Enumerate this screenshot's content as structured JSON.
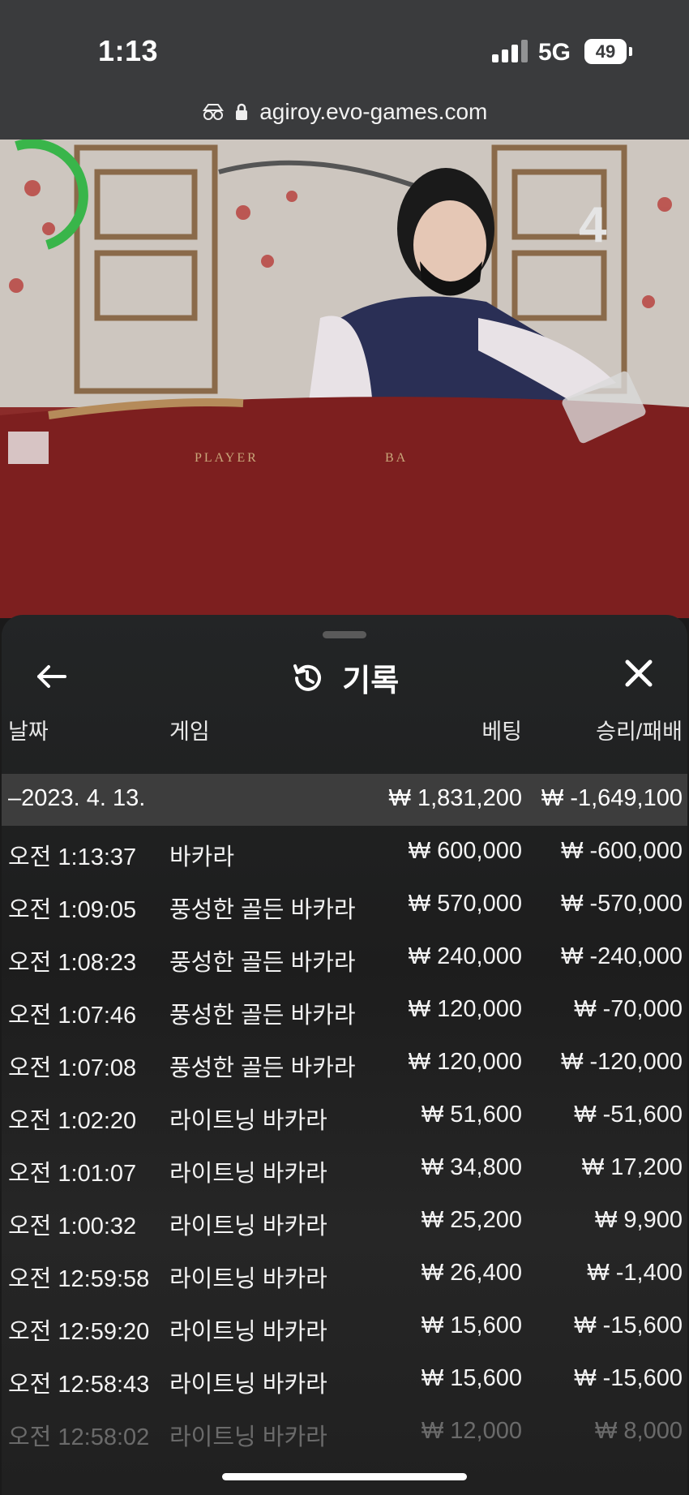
{
  "status_bar": {
    "time": "1:13",
    "network": "5G",
    "battery": "49"
  },
  "browser": {
    "url": "agiroy.evo-games.com"
  },
  "video": {
    "table_text_left": "PLAYER",
    "table_text_right": "BA",
    "countdown": "4"
  },
  "history": {
    "title": "기록",
    "columns": {
      "date": "날짜",
      "game": "게임",
      "bet": "베팅",
      "win_loss": "승리/패배"
    },
    "summary": {
      "date": "–2023. 4. 13.",
      "bet": "₩ 1,831,200",
      "win_loss": "₩ -1,649,100"
    },
    "rows": [
      {
        "time": "오전 1:13:37",
        "game": "바카라",
        "bet": "₩ 600,000",
        "win_loss": "₩ -600,000"
      },
      {
        "time": "오전 1:09:05",
        "game": "풍성한 골든 바카라",
        "bet": "₩ 570,000",
        "win_loss": "₩ -570,000"
      },
      {
        "time": "오전 1:08:23",
        "game": "풍성한 골든 바카라",
        "bet": "₩ 240,000",
        "win_loss": "₩ -240,000"
      },
      {
        "time": "오전 1:07:46",
        "game": "풍성한 골든 바카라",
        "bet": "₩ 120,000",
        "win_loss": "₩ -70,000"
      },
      {
        "time": "오전 1:07:08",
        "game": "풍성한 골든 바카라",
        "bet": "₩ 120,000",
        "win_loss": "₩ -120,000"
      },
      {
        "time": "오전 1:02:20",
        "game": "라이트닝 바카라",
        "bet": "₩ 51,600",
        "win_loss": "₩ -51,600"
      },
      {
        "time": "오전 1:01:07",
        "game": "라이트닝 바카라",
        "bet": "₩ 34,800",
        "win_loss": "₩ 17,200"
      },
      {
        "time": "오전 1:00:32",
        "game": "라이트닝 바카라",
        "bet": "₩ 25,200",
        "win_loss": "₩ 9,900"
      },
      {
        "time": "오전 12:59:58",
        "game": "라이트닝 바카라",
        "bet": "₩ 26,400",
        "win_loss": "₩ -1,400"
      },
      {
        "time": "오전 12:59:20",
        "game": "라이트닝 바카라",
        "bet": "₩ 15,600",
        "win_loss": "₩ -15,600"
      },
      {
        "time": "오전 12:58:43",
        "game": "라이트닝 바카라",
        "bet": "₩ 15,600",
        "win_loss": "₩ -15,600"
      },
      {
        "time": "오전 12:58:02",
        "game": "라이트닝 바카라",
        "bet": "₩ 12,000",
        "win_loss": "₩ 8,000"
      }
    ]
  }
}
